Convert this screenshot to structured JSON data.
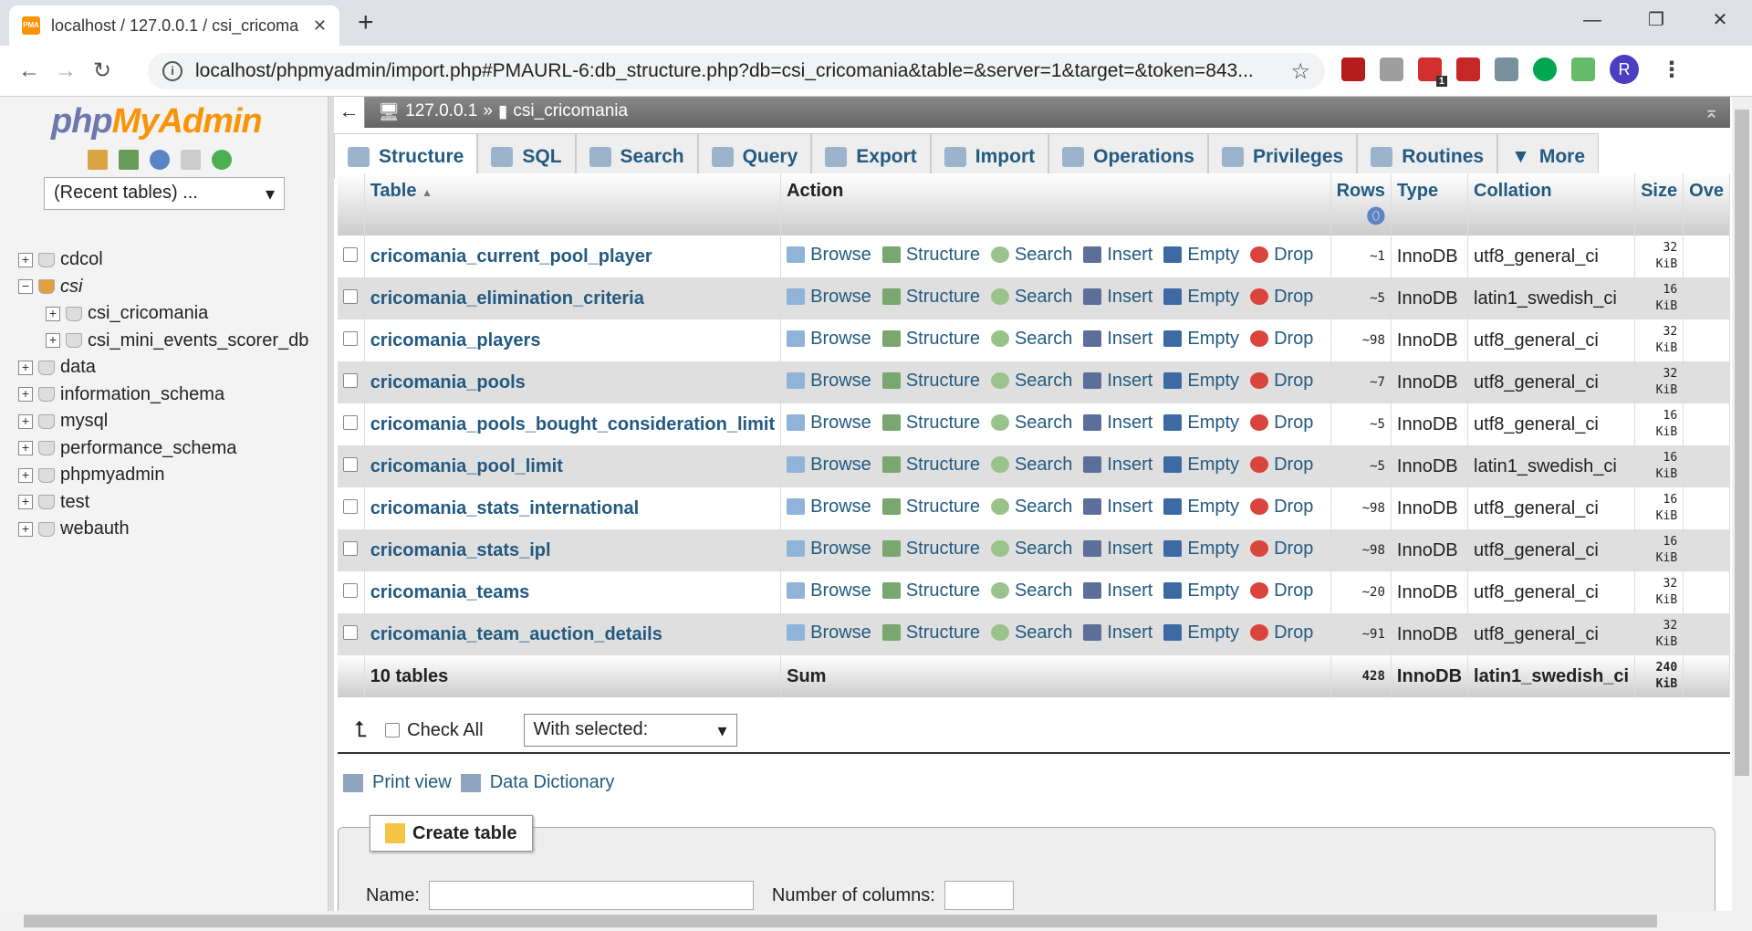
{
  "browser": {
    "tab_title": "localhost / 127.0.0.1 / csi_cricoma",
    "url": "localhost/phpmyadmin/import.php#PMAURL-6:db_structure.php?db=csi_cricomania&table=&server=1&target=&token=843...",
    "profile_initial": "R",
    "ext_badge": "1"
  },
  "sidebar": {
    "logo_a": "php",
    "logo_b": "MyAdmin",
    "recent": "(Recent tables) ...",
    "databases": [
      {
        "name": "cdcol",
        "sign": "+"
      },
      {
        "name": "csi",
        "sign": "−"
      },
      {
        "name": "csi_cricomania",
        "sign": "+"
      },
      {
        "name": "csi_mini_events_scorer_db",
        "sign": "+"
      },
      {
        "name": "data",
        "sign": "+"
      },
      {
        "name": "information_schema",
        "sign": "+"
      },
      {
        "name": "mysql",
        "sign": "+"
      },
      {
        "name": "performance_schema",
        "sign": "+"
      },
      {
        "name": "phpmyadmin",
        "sign": "+"
      },
      {
        "name": "test",
        "sign": "+"
      },
      {
        "name": "webauth",
        "sign": "+"
      }
    ]
  },
  "breadcrumb": {
    "server": "127.0.0.1",
    "sep": "»",
    "db": "csi_cricomania"
  },
  "tabs": [
    "Structure",
    "SQL",
    "Search",
    "Query",
    "Export",
    "Import",
    "Operations",
    "Privileges",
    "Routines",
    "More"
  ],
  "table": {
    "headers": {
      "table": "Table",
      "action": "Action",
      "rows": "Rows",
      "type": "Type",
      "collation": "Collation",
      "size": "Size",
      "overhead": "Ove"
    },
    "actions": [
      "Browse",
      "Structure",
      "Search",
      "Insert",
      "Empty",
      "Drop"
    ],
    "rows": [
      {
        "name": "cricomania_current_pool_player",
        "rows": "~1",
        "type": "InnoDB",
        "collation": "utf8_general_ci",
        "size": "32",
        "unit": "KiB"
      },
      {
        "name": "cricomania_elimination_criteria",
        "rows": "~5",
        "type": "InnoDB",
        "collation": "latin1_swedish_ci",
        "size": "16",
        "unit": "KiB"
      },
      {
        "name": "cricomania_players",
        "rows": "~98",
        "type": "InnoDB",
        "collation": "utf8_general_ci",
        "size": "32",
        "unit": "KiB"
      },
      {
        "name": "cricomania_pools",
        "rows": "~7",
        "type": "InnoDB",
        "collation": "utf8_general_ci",
        "size": "32",
        "unit": "KiB"
      },
      {
        "name": "cricomania_pools_bought_consideration_limit",
        "rows": "~5",
        "type": "InnoDB",
        "collation": "utf8_general_ci",
        "size": "16",
        "unit": "KiB"
      },
      {
        "name": "cricomania_pool_limit",
        "rows": "~5",
        "type": "InnoDB",
        "collation": "latin1_swedish_ci",
        "size": "16",
        "unit": "KiB"
      },
      {
        "name": "cricomania_stats_international",
        "rows": "~98",
        "type": "InnoDB",
        "collation": "utf8_general_ci",
        "size": "16",
        "unit": "KiB"
      },
      {
        "name": "cricomania_stats_ipl",
        "rows": "~98",
        "type": "InnoDB",
        "collation": "utf8_general_ci",
        "size": "16",
        "unit": "KiB"
      },
      {
        "name": "cricomania_teams",
        "rows": "~20",
        "type": "InnoDB",
        "collation": "utf8_general_ci",
        "size": "32",
        "unit": "KiB"
      },
      {
        "name": "cricomania_team_auction_details",
        "rows": "~91",
        "type": "InnoDB",
        "collation": "utf8_general_ci",
        "size": "32",
        "unit": "KiB"
      }
    ],
    "sum": {
      "label": "10 tables",
      "action": "Sum",
      "rows": "428",
      "type": "InnoDB",
      "collation": "latin1_swedish_ci",
      "size": "240",
      "unit": "KiB"
    }
  },
  "bulk": {
    "check_all": "Check All",
    "with_selected": "With selected:"
  },
  "links": {
    "print": "Print view",
    "dictionary": "Data Dictionary"
  },
  "create": {
    "button": "Create table",
    "name_label": "Name:",
    "columns_label": "Number of columns:"
  }
}
